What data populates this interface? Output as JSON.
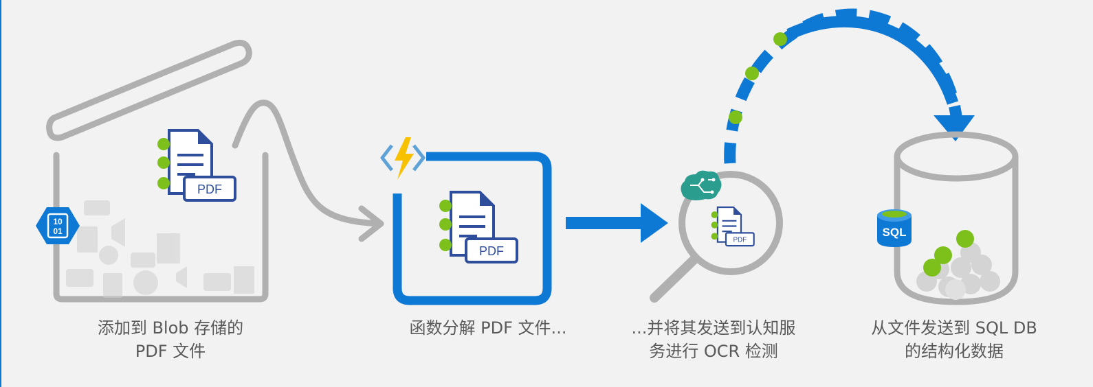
{
  "colors": {
    "background": "#f2f2f2",
    "outline_gray": "#b0b0b0",
    "azure_blue": "#0e78d5",
    "green_dot": "#7dc01c",
    "pdf_navy": "#2e4e9c",
    "bolt_yellow": "#f7c100",
    "brain_teal": "#2a9d8f",
    "text_gray": "#595959"
  },
  "icons": {
    "blob_storage": "binary-hexagon-icon",
    "azure_function": "lightning-bolt-brackets-icon",
    "cognitive_services": "brain-circuit-icon",
    "sql_database": "sql-cylinder-icon",
    "pdf_document": "pdf-document-icon"
  },
  "labels": {
    "pdf_tag": "PDF",
    "blob_badge_top": "10",
    "blob_badge_bottom": "01",
    "sql_badge": "SQL"
  },
  "steps": [
    {
      "line1": "添加到 Blob 存储的",
      "line2": "PDF 文件"
    },
    {
      "line1": "函数分解 PDF 文件...",
      "line2": ""
    },
    {
      "line1": "...并将其发送到认知服",
      "line2": "务进行 OCR 检测"
    },
    {
      "line1": "从文件发送到 SQL DB",
      "line2": "的结构化数据"
    }
  ]
}
